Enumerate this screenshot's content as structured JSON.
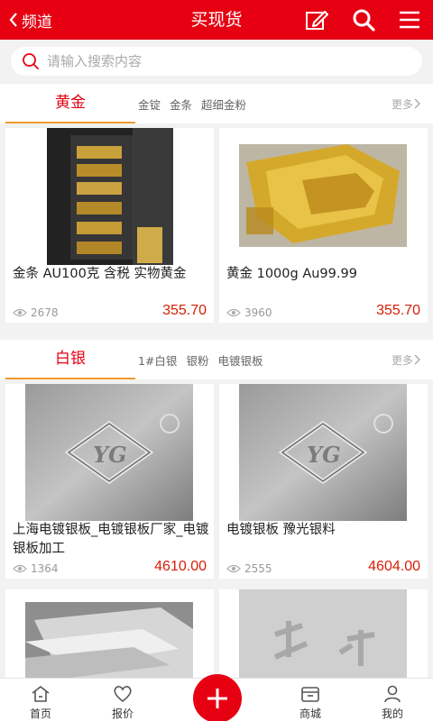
{
  "header": {
    "back_label": "频道",
    "title": "买现货"
  },
  "search": {
    "placeholder": "请输入搜索内容",
    "value": ""
  },
  "sections": [
    {
      "title": "黄金",
      "tags": [
        "金锭",
        "金条",
        "超细金粉"
      ],
      "more": "更多",
      "products": [
        {
          "name": "金条 AU100克 含税 实物黄金",
          "views": "2678",
          "price": "355.70"
        },
        {
          "name": "黄金 1000g Au99.99",
          "views": "3960",
          "price": "355.70"
        }
      ]
    },
    {
      "title": "白银",
      "tags": [
        "1#白银",
        "银粉",
        "电镀银板"
      ],
      "more": "更多",
      "products": [
        {
          "name": "上海电镀银板_电镀银板厂家_电镀银板加工",
          "views": "1364",
          "price": "4610.00",
          "logo": "YG"
        },
        {
          "name": "电镀银板 豫光银料",
          "views": "2555",
          "price": "4604.00",
          "logo": "YG"
        },
        {
          "name": "",
          "views": "",
          "price": ""
        },
        {
          "name": "",
          "views": "",
          "price": ""
        }
      ]
    }
  ],
  "nav": {
    "home": "首页",
    "quote": "报价",
    "mall": "商城",
    "mine": "我的"
  },
  "colors": {
    "brand_red": "#e60012",
    "price_red": "#d81e06",
    "tab_underline": "#f29a2e"
  }
}
